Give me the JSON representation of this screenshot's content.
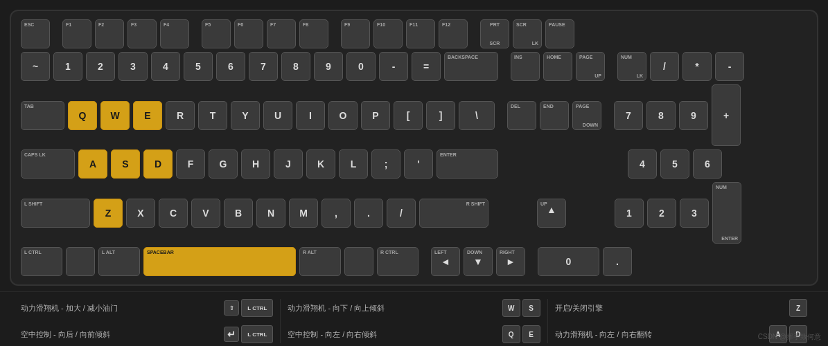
{
  "keyboard": {
    "rows": [
      {
        "id": "fn-row",
        "keys": [
          {
            "id": "esc",
            "label": "ESC",
            "top": "",
            "wide": "unit",
            "highlighted": false
          },
          {
            "id": "f1",
            "label": "F1",
            "top": "",
            "wide": "unit",
            "highlighted": false
          },
          {
            "id": "f2",
            "label": "F2",
            "top": "",
            "wide": "unit",
            "highlighted": false
          },
          {
            "id": "f3",
            "label": "F3",
            "top": "",
            "wide": "unit",
            "highlighted": false
          },
          {
            "id": "f4",
            "label": "F4",
            "top": "",
            "wide": "unit",
            "highlighted": false
          },
          {
            "id": "f5",
            "label": "F5",
            "top": "",
            "wide": "unit",
            "highlighted": false
          },
          {
            "id": "f6",
            "label": "F6",
            "top": "",
            "wide": "unit",
            "highlighted": false
          },
          {
            "id": "f7",
            "label": "F7",
            "top": "",
            "wide": "unit",
            "highlighted": false
          },
          {
            "id": "f8",
            "label": "F8",
            "top": "",
            "wide": "unit",
            "highlighted": false
          },
          {
            "id": "f9",
            "label": "F9",
            "top": "",
            "wide": "unit",
            "highlighted": false
          },
          {
            "id": "f10",
            "label": "F10",
            "top": "",
            "wide": "unit",
            "highlighted": false
          },
          {
            "id": "f11",
            "label": "F11",
            "top": "",
            "wide": "unit",
            "highlighted": false
          },
          {
            "id": "f12",
            "label": "F12",
            "top": "",
            "wide": "unit",
            "highlighted": false
          },
          {
            "id": "prt",
            "label": "PRT\nSCR",
            "top": "",
            "wide": "unit",
            "highlighted": false
          },
          {
            "id": "scrlk",
            "label": "SCR\nLK",
            "top": "",
            "wide": "unit",
            "highlighted": false
          },
          {
            "id": "pause",
            "label": "PAUSE",
            "top": "",
            "wide": "unit",
            "highlighted": false
          }
        ]
      }
    ],
    "highlighted_keys": [
      "Q",
      "W",
      "E",
      "A",
      "S",
      "D",
      "Z"
    ],
    "accent_color": "#d4a017"
  },
  "info_items": [
    {
      "col": 0,
      "items": [
        {
          "text": "动力滑翔机 - 加大 / 减小油门",
          "keys": [
            "⇧",
            "L CTRL"
          ],
          "key_types": [
            "icon",
            "wide"
          ]
        },
        {
          "text": "空中控制 - 向后 / 向前倾斜",
          "keys": [
            "⏎",
            "L CTRL"
          ],
          "key_types": [
            "icon",
            "wide"
          ]
        }
      ]
    },
    {
      "col": 1,
      "items": [
        {
          "text": "动力滑翔机 - 向下 / 向上倾斜",
          "keys": [
            "W",
            "S"
          ],
          "key_types": [
            "normal",
            "normal"
          ]
        },
        {
          "text": "空中控制 - 向左 / 向右倾斜",
          "keys": [
            "Q",
            "E"
          ],
          "key_types": [
            "normal",
            "normal"
          ]
        }
      ]
    },
    {
      "col": 2,
      "items": [
        {
          "text": "开启/关闭引擎",
          "keys": [
            "Z"
          ],
          "key_types": [
            "normal"
          ]
        },
        {
          "text": "动力滑翔机 - 向左 / 向右翻转",
          "keys": [
            "A",
            "D"
          ],
          "key_types": [
            "normal",
            "normal"
          ]
        }
      ]
    }
  ],
  "watermark": "CSDN @挥手致何意"
}
